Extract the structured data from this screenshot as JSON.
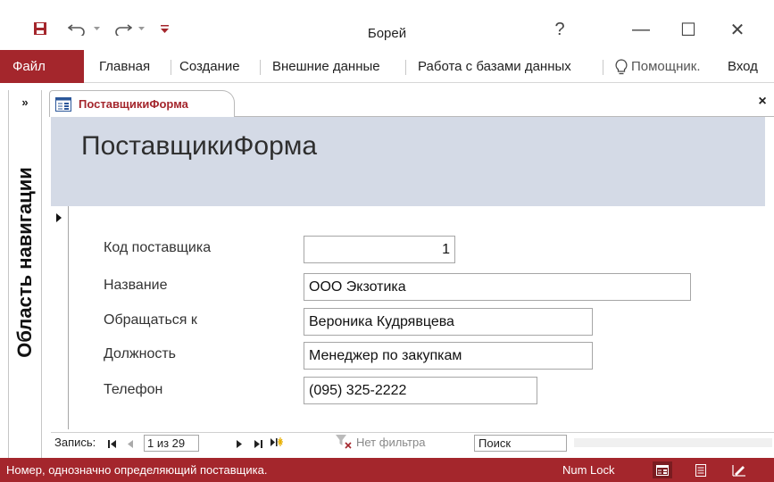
{
  "app": {
    "title": "Борей",
    "help_glyph": "?",
    "minimize_glyph": "—",
    "maximize_glyph": "☐",
    "close_glyph": "✕"
  },
  "quick_access": {
    "icons": [
      "save-icon",
      "undo-icon",
      "redo-icon",
      "customize-qat-icon"
    ]
  },
  "ribbon": {
    "file_label": "Файл",
    "tabs": [
      "Главная",
      "Создание",
      "Внешние данные",
      "Работа с базами данных"
    ],
    "assistant_label": "Помощник.",
    "signin_label": "Вход"
  },
  "nav_pane": {
    "toggle_glyph": "»",
    "label": "Область навигации"
  },
  "document": {
    "tab_label": "ПоставщикиФорма",
    "close_glyph": "×",
    "form_title": "ПоставщикиФорма",
    "fields": [
      {
        "label": "Код поставщика",
        "value": "1"
      },
      {
        "label": "Название",
        "value": "ООО Экзотика"
      },
      {
        "label": "Обращаться к",
        "value": "Вероника Кудрявцева"
      },
      {
        "label": "Должность",
        "value": "Менеджер по закупкам"
      },
      {
        "label": "Телефон",
        "value": "(095) 325-2222"
      }
    ]
  },
  "record_nav": {
    "record_label": "Запись:",
    "position": "1 из 29",
    "filter_label": "Нет фильтра",
    "search_placeholder": "Поиск"
  },
  "status": {
    "text": "Номер, однозначно определяющий поставщика.",
    "numlock": "Num Lock",
    "view_icons": [
      "form-view-icon",
      "layout-view-icon",
      "design-view-icon"
    ]
  },
  "colors": {
    "accent": "#a4262c",
    "form_header": "#d4dae6"
  }
}
